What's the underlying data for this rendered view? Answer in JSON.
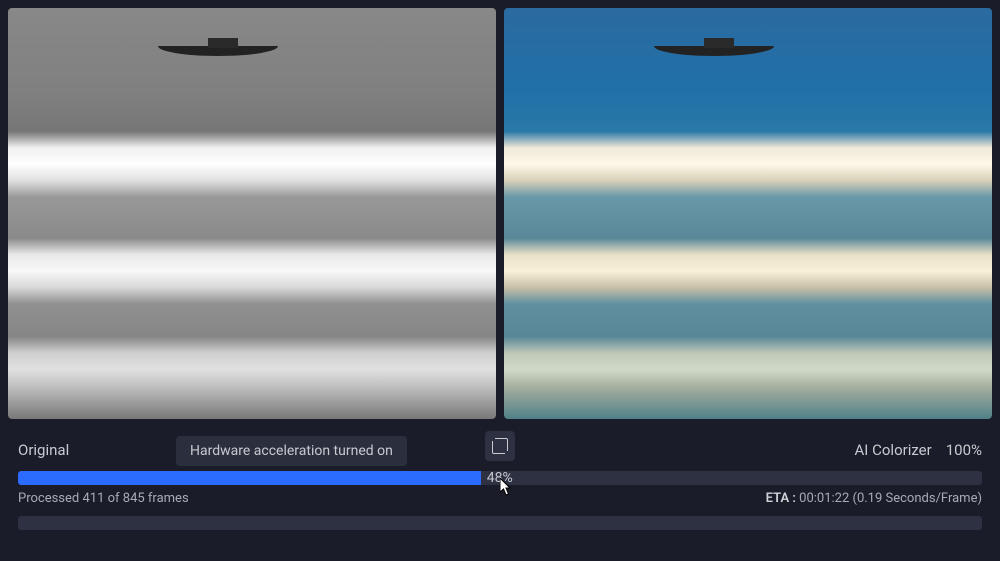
{
  "labels": {
    "original": "Original",
    "processed": "AI Colorizer",
    "zoom": "100%"
  },
  "tooltip": {
    "text": "Hardware acceleration turned on"
  },
  "progress": {
    "percent": 48,
    "percent_label": "48%",
    "frames_text": "Processed 411 of 845 frames",
    "eta_prefix": "ETA : ",
    "eta_value": "00:01:22 (0.19 Seconds/Frame)"
  },
  "icons": {
    "compare": "compare-icon"
  }
}
